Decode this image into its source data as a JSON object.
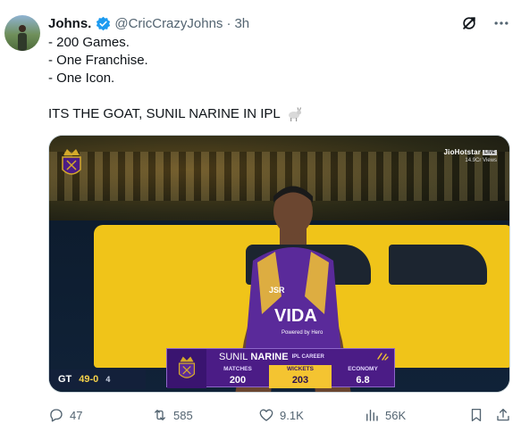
{
  "author": {
    "display_name": "Johns.",
    "handle": "@CricCrazyJohns",
    "separator": "·",
    "time": "3h"
  },
  "tweet": {
    "lines": [
      "- 200 Games.",
      "- One Franchise.",
      "- One Icon."
    ],
    "headline": "ITS THE GOAT, SUNIL NARINE IN IPL"
  },
  "media": {
    "broadcaster": "JioHotstar",
    "live_badge": "LIVE",
    "views_text": "14.9Cr Views",
    "jersey_sponsor": "VIDA",
    "jersey_sub": "Powered by Hero",
    "scorebug": {
      "team": "GT",
      "score": "49-0",
      "overs": "4"
    },
    "stat_card": {
      "first_name": "SUNIL",
      "last_name": "NARINE",
      "subtitle": "IPL CAREER",
      "stats": [
        {
          "label": "MATCHES",
          "value": "200",
          "highlight": false
        },
        {
          "label": "WICKETS",
          "value": "203",
          "highlight": true
        },
        {
          "label": "ECONOMY",
          "value": "6.8",
          "highlight": false
        }
      ]
    }
  },
  "metrics": {
    "replies": "47",
    "retweets": "585",
    "likes": "9.1K",
    "views": "56K"
  },
  "icons": {
    "verified": "verified-badge-icon",
    "grok": "grok-icon",
    "more": "more-icon",
    "reply": "reply-icon",
    "retweet": "retweet-icon",
    "like": "heart-icon",
    "views": "views-icon",
    "bookmark": "bookmark-icon",
    "share": "share-icon",
    "goat": "goat-emoji-icon"
  },
  "colors": {
    "verified": "#1d9bf0",
    "muted": "#536471",
    "text": "#0f1419",
    "kkr_purple": "#4b1c86",
    "kkr_gold": "#f4c431"
  }
}
